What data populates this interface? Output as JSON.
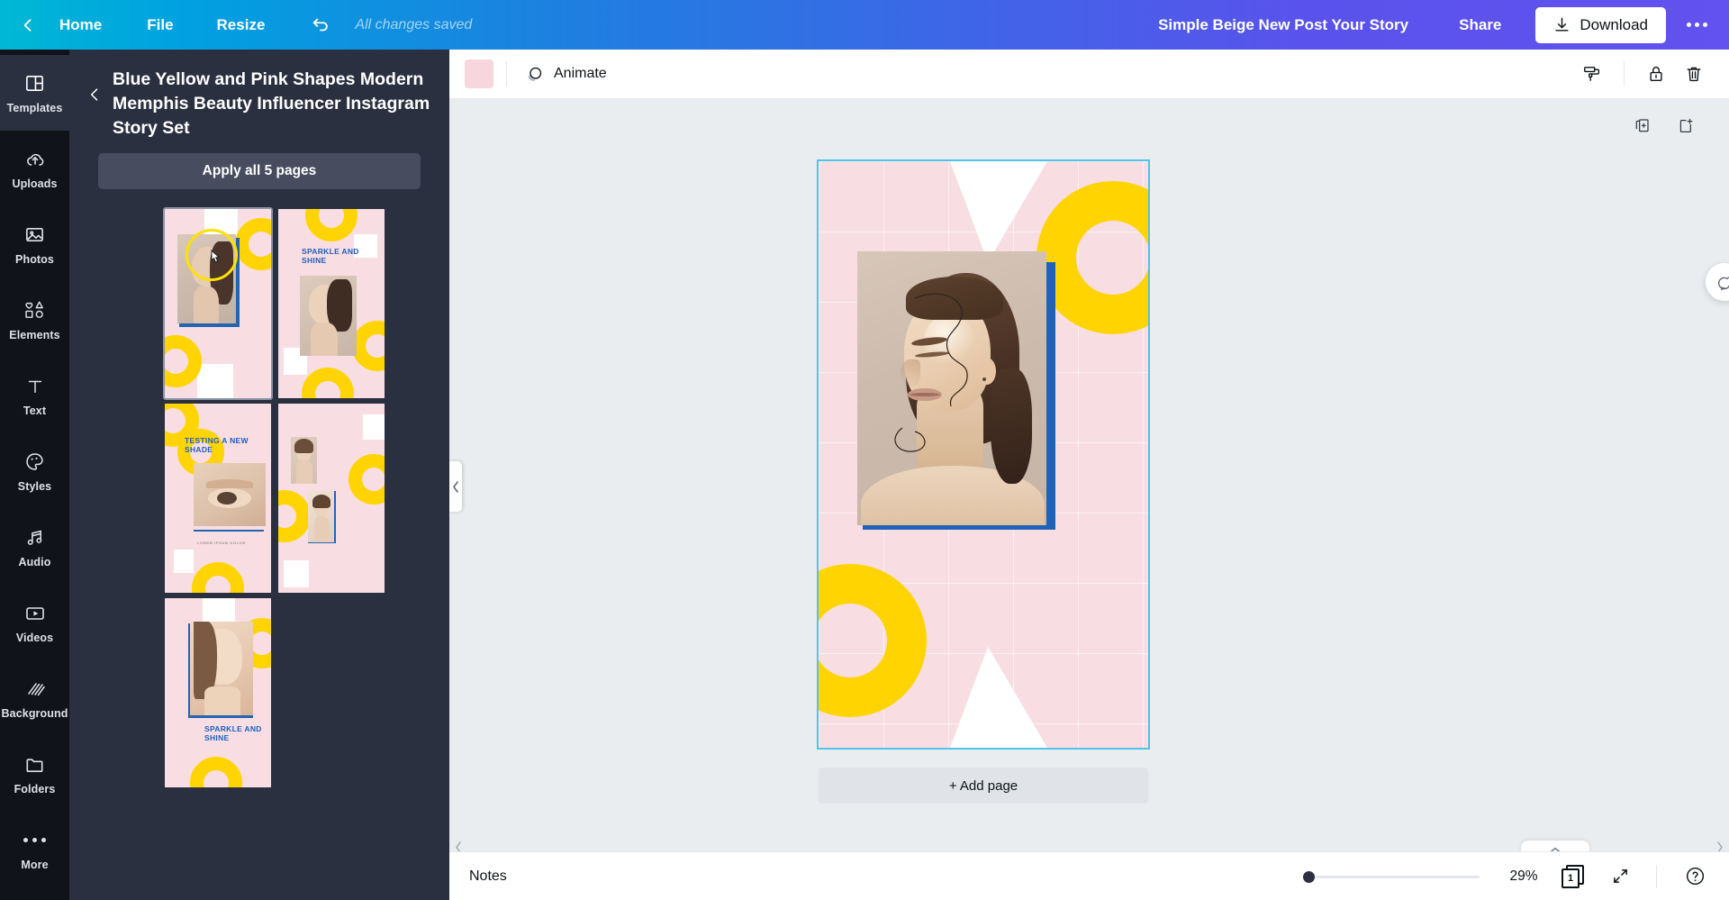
{
  "topbar": {
    "back_icon": "chevron-left-icon",
    "home_label": "Home",
    "file_label": "File",
    "resize_label": "Resize",
    "undo_icon": "undo-icon",
    "save_status": "All changes saved",
    "design_title": "Simple Beige New Post Your Story",
    "share_label": "Share",
    "download_label": "Download",
    "download_icon": "download-icon",
    "more_icon": "more-horizontal-icon",
    "accent_gradient_start": "#00b8d4",
    "accent_gradient_end": "#6252ef"
  },
  "rail": {
    "items": [
      {
        "label": "Templates",
        "icon": "templates-icon",
        "active": true
      },
      {
        "label": "Uploads",
        "icon": "cloud-upload-icon",
        "active": false
      },
      {
        "label": "Photos",
        "icon": "image-icon",
        "active": false
      },
      {
        "label": "Elements",
        "icon": "shapes-icon",
        "active": false
      },
      {
        "label": "Text",
        "icon": "text-t-icon",
        "active": false
      },
      {
        "label": "Styles",
        "icon": "palette-icon",
        "active": false
      },
      {
        "label": "Audio",
        "icon": "music-note-icon",
        "active": false
      },
      {
        "label": "Videos",
        "icon": "video-play-icon",
        "active": false
      },
      {
        "label": "Background",
        "icon": "hatch-pattern-icon",
        "active": false
      },
      {
        "label": "Folders",
        "icon": "folder-icon",
        "active": false
      },
      {
        "label": "More",
        "icon": "more-horizontal-icon",
        "active": false
      }
    ]
  },
  "panel": {
    "back_icon": "chevron-left-icon",
    "title": "Blue Yellow and Pink Shapes Modern Memphis Beauty Influencer Instagram Story Set",
    "apply_all_label": "Apply all 5 pages",
    "collapse_icon": "chevron-left-icon",
    "thumbnails": [
      {
        "name": "template-thumb-1",
        "selected": true,
        "caption": "",
        "variant": "portrait-circle"
      },
      {
        "name": "template-thumb-2",
        "selected": false,
        "caption": "SPARKLE AND SHINE",
        "variant": "sparkle-portrait"
      },
      {
        "name": "template-thumb-3",
        "selected": false,
        "caption": "TESTING A NEW SHADE",
        "variant": "eye-closeup"
      },
      {
        "name": "template-thumb-4",
        "selected": false,
        "caption": "",
        "variant": "two-portraits"
      },
      {
        "name": "template-thumb-5",
        "selected": false,
        "caption": "SPARKLE AND SHINE",
        "variant": "wet-hair-portrait"
      }
    ]
  },
  "editor_toolbar": {
    "color_swatch": "#f7d7dd",
    "animate_label": "Animate",
    "animate_icon": "animate-circle-icon",
    "paint_roller_icon": "paint-roller-icon",
    "lock_icon": "lock-icon",
    "delete_icon": "trash-icon"
  },
  "canvas": {
    "duplicate_page_icon": "duplicate-page-icon",
    "add_page_icon": "add-page-icon",
    "comment_icon": "add-comment-icon",
    "add_page_label": "+ Add page",
    "selection_color": "#4fc3e8",
    "page_bg": "#f8dee3",
    "accent_yellow": "#ffd400",
    "accent_blue": "#1f63b8"
  },
  "bottombar": {
    "notes_label": "Notes",
    "zoom_percent": "29%",
    "page_number": "1",
    "page_count_icon": "page-count-icon",
    "fullscreen_icon": "expand-icon",
    "help_icon": "help-circle-icon",
    "scroll_left_icon": "chevron-left-icon",
    "scroll_right_icon": "chevron-right-icon"
  }
}
